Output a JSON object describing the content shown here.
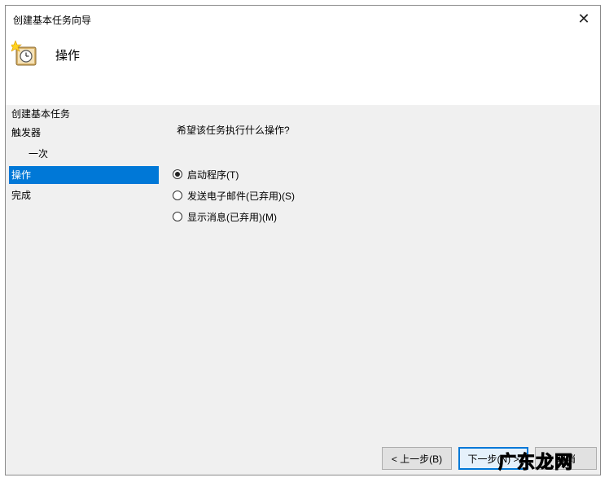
{
  "window": {
    "title": "创建基本任务向导",
    "close_glyph": "✕"
  },
  "header": {
    "title": "操作",
    "icon": "task-clock-icon"
  },
  "sidebar": {
    "items": [
      {
        "label": "创建基本任务",
        "selected": false,
        "sub": false
      },
      {
        "label": "触发器",
        "selected": false,
        "sub": false
      },
      {
        "label": "一次",
        "selected": false,
        "sub": true
      },
      {
        "label": "操作",
        "selected": true,
        "sub": false
      },
      {
        "label": "完成",
        "selected": false,
        "sub": false
      }
    ]
  },
  "content": {
    "question": "希望该任务执行什么操作?",
    "options": [
      {
        "label": "启动程序(T)",
        "checked": true
      },
      {
        "label": "发送电子邮件(已弃用)(S)",
        "checked": false
      },
      {
        "label": "显示消息(已弃用)(M)",
        "checked": false
      }
    ]
  },
  "buttons": {
    "back": "< 上一步(B)",
    "next": "下一步(N) >",
    "cancel": "取消"
  },
  "watermark": {
    "text": "广东龙网"
  },
  "colors": {
    "selection": "#0078d7",
    "dialog_bg": "#f0f0f0"
  }
}
